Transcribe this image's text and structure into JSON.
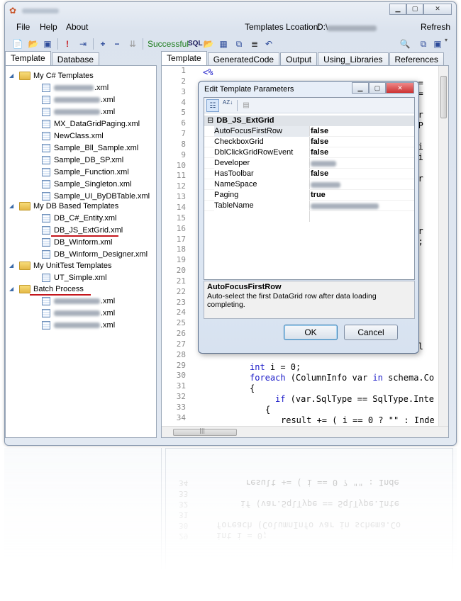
{
  "window": {
    "title_blurred": true,
    "caption_buttons": [
      "minimize",
      "restore",
      "close"
    ]
  },
  "menu": {
    "file": "File",
    "help": "Help",
    "about": "About",
    "templates_location_label": "Templates Lcoation:",
    "templates_location_value": "D:\\",
    "refresh": "Refresh"
  },
  "toolbar": {
    "status": "Successful",
    "sql": "SQL"
  },
  "left_tabs": [
    {
      "label": "Template",
      "active": true
    },
    {
      "label": "Database",
      "active": false
    }
  ],
  "tree": {
    "groups": [
      {
        "label": "My C# Templates",
        "items": [
          ".xml",
          ".xml",
          ".xml",
          "MX_DataGridPaging.xml",
          "NewClass.xml",
          "Sample_Bll_Sample.xml",
          "Sample_DB_SP.xml",
          "Sample_Function.xml",
          "Sample_Singleton.xml",
          "Sample_UI_ByDBTable.xml"
        ]
      },
      {
        "label": "My DB Based Templates",
        "items": [
          "DB_C#_Entity.xml",
          "DB_JS_ExtGrid.xml",
          "DB_Winform.xml",
          "DB_Winform_Designer.xml"
        ]
      },
      {
        "label": "My UnitTest Templates",
        "items": [
          "UT_Simple.xml"
        ]
      },
      {
        "label": "Batch Process",
        "items": [
          ".xml",
          ".xml",
          ".xml"
        ]
      }
    ]
  },
  "right_tabs": [
    {
      "label": "Template",
      "active": true
    },
    {
      "label": "GeneratedCode"
    },
    {
      "label": "Output"
    },
    {
      "label": "Using_Libraries"
    },
    {
      "label": "References"
    }
  ],
  "editor": {
    "line_numbers": [
      "1",
      "2",
      "3",
      "4",
      "5",
      "6",
      "7",
      "8",
      "9",
      "10",
      "11",
      "12",
      "13",
      "14",
      "15",
      "16",
      "17",
      "18",
      "19",
      "20",
      "21",
      "22",
      "23",
      "24",
      "25",
      "26",
      "27",
      "28",
      "29",
      "30",
      "31",
      "32",
      "33",
      "34"
    ],
    "lines": {
      "l1": "<%",
      "r2": "on =",
      "r3": "on =",
      "r4": "= \"",
      "r5": "ppor",
      "r6": "= \"P",
      "r7": "n =",
      "r8": "scri",
      "r9": "ipti",
      "r11": "(str",
      "r13": ")",
      "r16": "ider",
      "r17": "me);",
      "r21": "lds",
      "r27": "tabl",
      "l29a": "int",
      "l29b": " i = 0;",
      "l30a": "foreach",
      "l30b": " (ColumnInfo var ",
      "l30c": "in",
      "l30d": " schema.Co",
      "l31": "{",
      "l32a": "if",
      "l32b": " (var.SqlType == SqlType.Inte",
      "l33": "{",
      "l34": "result += ( i == 0 ? \"\" : Inde"
    },
    "hscroll_glyph": "|||"
  },
  "dialog": {
    "title": "Edit Template Parameters",
    "sort_az": "AZ",
    "category": "DB_JS_ExtGrid",
    "properties": [
      {
        "name": "AutoFocusFirstRow",
        "value": "false"
      },
      {
        "name": "CheckboxGrid",
        "value": "false"
      },
      {
        "name": "DblClickGridRowEvent",
        "value": "false"
      },
      {
        "name": "Developer",
        "value": ""
      },
      {
        "name": "HasToolbar",
        "value": "false"
      },
      {
        "name": "NameSpace",
        "value": ""
      },
      {
        "name": "Paging",
        "value": "true"
      },
      {
        "name": "TableName",
        "value": ""
      }
    ],
    "help_name": "AutoFocusFirstRow",
    "help_desc": "Auto-select the first DataGrid row after data loading completing.",
    "ok": "OK",
    "cancel": "Cancel"
  },
  "reflection_lines": {
    "r34": "result += ( i == 0 ? \"\" : Inde",
    "r32": "if (var.SqlType == SqlType.Inte",
    "r30": "foreach (ColumnInfo var in schema.Co",
    "r29": "int i = 0;"
  },
  "colors": {
    "keyword": "#1a1ac8",
    "status_green": "#1e7d1e",
    "underline_red": "#c4161c"
  }
}
